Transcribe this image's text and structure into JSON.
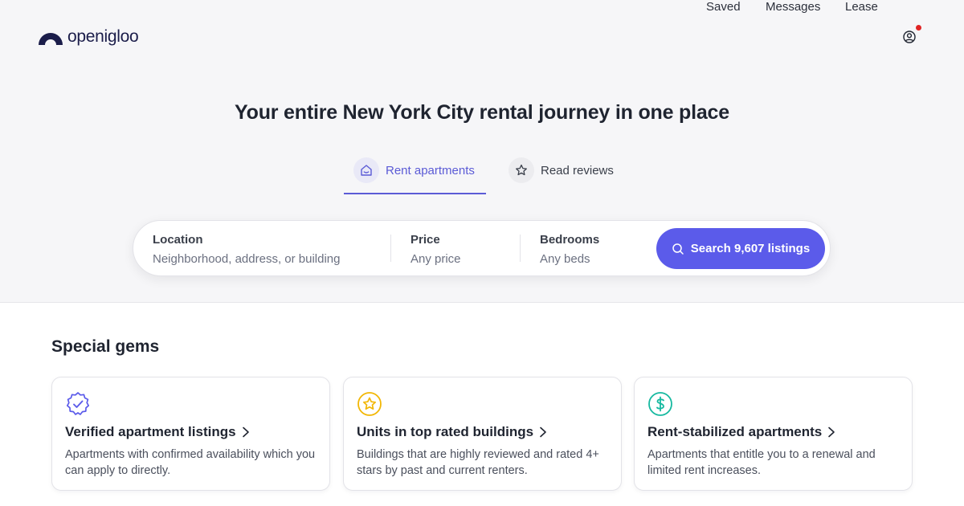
{
  "brand": {
    "name": "openigloo",
    "color": "#1b1d4a"
  },
  "nav": {
    "links": [
      "Saved",
      "Messages",
      "Lease"
    ],
    "profile_icon": "user-circle-icon",
    "notification_color": "#e02424"
  },
  "hero": {
    "headline": "Your entire New York City rental journey in one place",
    "tabs": [
      {
        "label": "Rent apartments",
        "icon": "home-icon",
        "active": true
      },
      {
        "label": "Read reviews",
        "icon": "star-icon",
        "active": false
      }
    ]
  },
  "search": {
    "location": {
      "label": "Location",
      "placeholder": "Neighborhood, address, or building"
    },
    "price": {
      "label": "Price",
      "value": "Any price"
    },
    "bedrooms": {
      "label": "Bedrooms",
      "value": "Any beds"
    },
    "button_label": "Search 9,607 listings",
    "button_color": "#5b5bea"
  },
  "gems": {
    "title": "Special gems",
    "cards": [
      {
        "title": "Verified apartment listings",
        "description": "Apartments with confirmed availability which you can apply to directly.",
        "icon": "verified-badge-icon",
        "icon_color": "#5b5bea"
      },
      {
        "title": "Units in top rated buildings",
        "description": "Buildings that are highly reviewed and rated 4+ stars by past and current renters.",
        "icon": "star-circle-icon",
        "icon_color": "#f2b705"
      },
      {
        "title": "Rent-stabilized apartments",
        "description": "Apartments that entitle you to a renewal and limited rent increases.",
        "icon": "dollar-circle-icon",
        "icon_color": "#16b9a0"
      }
    ]
  }
}
